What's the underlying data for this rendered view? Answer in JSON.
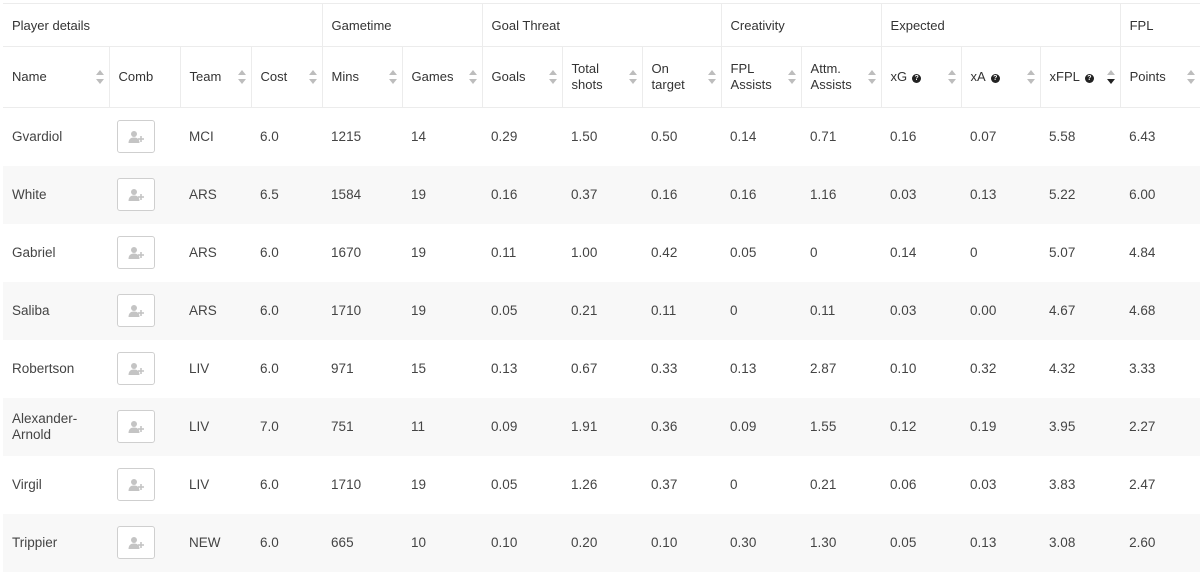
{
  "groups": [
    {
      "label": "Player details"
    },
    {
      "label": "Gametime"
    },
    {
      "label": "Goal Threat"
    },
    {
      "label": "Creativity"
    },
    {
      "label": "Expected"
    },
    {
      "label": "FPL"
    }
  ],
  "columns": [
    {
      "label": "Name",
      "sortable": true
    },
    {
      "label": "Comb",
      "sortable": false
    },
    {
      "label": "Team",
      "sortable": true
    },
    {
      "label": "Cost",
      "sortable": true
    },
    {
      "label": "Mins",
      "sortable": true
    },
    {
      "label": "Games",
      "sortable": true
    },
    {
      "label": "Goals",
      "sortable": true
    },
    {
      "label": "Total shots",
      "sortable": true
    },
    {
      "label": "On target",
      "sortable": true
    },
    {
      "label": "FPL Assists",
      "sortable": true
    },
    {
      "label": "Attm. Assists",
      "sortable": true
    },
    {
      "label": "xG",
      "sortable": true,
      "help_icon": "question-circle-icon"
    },
    {
      "label": "xA",
      "sortable": true,
      "help_icon": "question-circle-icon"
    },
    {
      "label": "xFPL",
      "sortable": true,
      "help_icon": "question-circle-icon",
      "sort_direction": "descending"
    },
    {
      "label": "Points",
      "sortable": true
    }
  ],
  "help_glyph": "?",
  "comb_button_icon": "add-user-icon",
  "rows": [
    {
      "name": "Gvardiol",
      "team": "MCI",
      "cost": "6.0",
      "mins": "1215",
      "games": "14",
      "goals": "0.29",
      "total_shots": "1.50",
      "on_target": "0.50",
      "fpl_assists": "0.14",
      "attm_assists": "0.71",
      "xg": "0.16",
      "xa": "0.07",
      "xfpl": "5.58",
      "points": "6.43"
    },
    {
      "name": "White",
      "team": "ARS",
      "cost": "6.5",
      "mins": "1584",
      "games": "19",
      "goals": "0.16",
      "total_shots": "0.37",
      "on_target": "0.16",
      "fpl_assists": "0.16",
      "attm_assists": "1.16",
      "xg": "0.03",
      "xa": "0.13",
      "xfpl": "5.22",
      "points": "6.00"
    },
    {
      "name": "Gabriel",
      "team": "ARS",
      "cost": "6.0",
      "mins": "1670",
      "games": "19",
      "goals": "0.11",
      "total_shots": "1.00",
      "on_target": "0.42",
      "fpl_assists": "0.05",
      "attm_assists": "0",
      "xg": "0.14",
      "xa": "0",
      "xfpl": "5.07",
      "points": "4.84"
    },
    {
      "name": "Saliba",
      "team": "ARS",
      "cost": "6.0",
      "mins": "1710",
      "games": "19",
      "goals": "0.05",
      "total_shots": "0.21",
      "on_target": "0.11",
      "fpl_assists": "0",
      "attm_assists": "0.11",
      "xg": "0.03",
      "xa": "0.00",
      "xfpl": "4.67",
      "points": "4.68"
    },
    {
      "name": "Robertson",
      "team": "LIV",
      "cost": "6.0",
      "mins": "971",
      "games": "15",
      "goals": "0.13",
      "total_shots": "0.67",
      "on_target": "0.33",
      "fpl_assists": "0.13",
      "attm_assists": "2.87",
      "xg": "0.10",
      "xa": "0.32",
      "xfpl": "4.32",
      "points": "3.33"
    },
    {
      "name": "Alexander-Arnold",
      "team": "LIV",
      "cost": "7.0",
      "mins": "751",
      "games": "11",
      "goals": "0.09",
      "total_shots": "1.91",
      "on_target": "0.36",
      "fpl_assists": "0.09",
      "attm_assists": "1.55",
      "xg": "0.12",
      "xa": "0.19",
      "xfpl": "3.95",
      "points": "2.27"
    },
    {
      "name": "Virgil",
      "team": "LIV",
      "cost": "6.0",
      "mins": "1710",
      "games": "19",
      "goals": "0.05",
      "total_shots": "1.26",
      "on_target": "0.37",
      "fpl_assists": "0",
      "attm_assists": "0.21",
      "xg": "0.06",
      "xa": "0.03",
      "xfpl": "3.83",
      "points": "2.47"
    },
    {
      "name": "Trippier",
      "team": "NEW",
      "cost": "6.0",
      "mins": "665",
      "games": "10",
      "goals": "0.10",
      "total_shots": "0.20",
      "on_target": "0.10",
      "fpl_assists": "0.30",
      "attm_assists": "1.30",
      "xg": "0.05",
      "xa": "0.13",
      "xfpl": "3.08",
      "points": "2.60"
    }
  ]
}
